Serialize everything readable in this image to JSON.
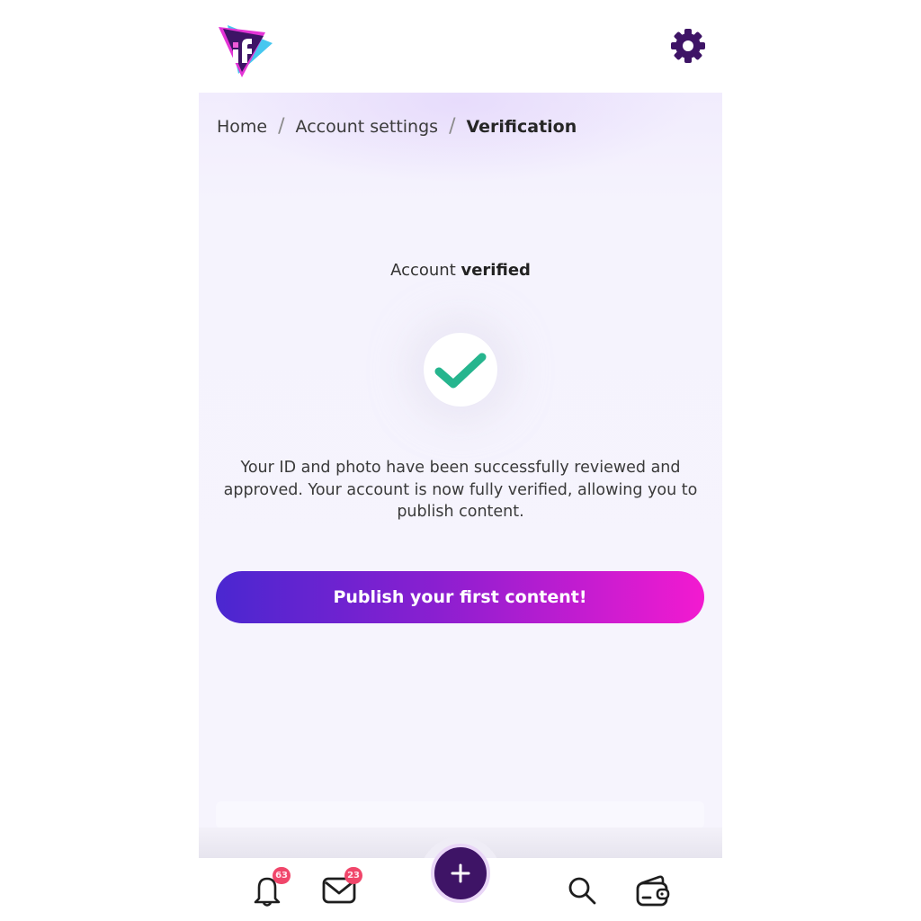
{
  "header": {
    "logo_text": "iF",
    "settings_icon": "gear-icon"
  },
  "breadcrumb": {
    "items": [
      "Home",
      "Account settings"
    ],
    "separator": "/",
    "current": "Verification"
  },
  "status": {
    "prefix": "Account ",
    "emphasis": "verified",
    "icon": "check-icon"
  },
  "description": "Your ID and photo have been successfully reviewed and approved. Your account is now fully verified, allowing you to publish content.",
  "cta": {
    "label": "Publish your first content!"
  },
  "bottom_nav": {
    "notifications": {
      "icon": "bell-icon",
      "badge": "63"
    },
    "messages": {
      "icon": "mail-icon",
      "badge": "23"
    },
    "create": {
      "icon": "plus-icon"
    },
    "search": {
      "icon": "search-icon"
    },
    "wallet": {
      "icon": "wallet-icon"
    }
  },
  "colors": {
    "brand_dark": "#3e1466",
    "check_green": "#26b58e",
    "badge_red": "#f0466a",
    "cta_gradient_start": "#4a27d0",
    "cta_gradient_end": "#f31ad0"
  }
}
